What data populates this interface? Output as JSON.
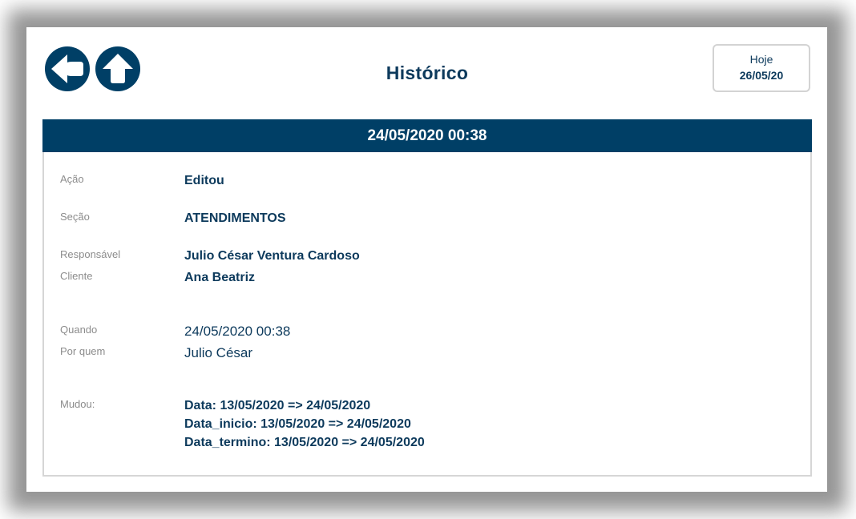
{
  "header": {
    "title": "Histórico",
    "today_label": "Hoje",
    "today_date": "26/05/20"
  },
  "icons": {
    "back": "arrow-left-icon",
    "up": "arrow-up-icon"
  },
  "colors": {
    "primary": "#003f66",
    "text": "#0d3a5c",
    "label": "#8c8c8c"
  },
  "record": {
    "timestamp": "24/05/2020 00:38",
    "fields": {
      "acao_label": "Ação",
      "acao_value": "Editou",
      "secao_label": "Seção",
      "secao_value": "ATENDIMENTOS",
      "responsavel_label": "Responsável",
      "responsavel_value": "Julio César Ventura Cardoso",
      "cliente_label": "Cliente",
      "cliente_value": "Ana Beatriz",
      "quando_label": "Quando",
      "quando_value": "24/05/2020 00:38",
      "porquem_label": "Por quem",
      "porquem_value": "Julio César",
      "mudou_label": "Mudou:"
    },
    "changes": [
      "Data: 13/05/2020 => 24/05/2020",
      "Data_inicio: 13/05/2020 => 24/05/2020",
      "Data_termino: 13/05/2020 => 24/05/2020"
    ]
  }
}
